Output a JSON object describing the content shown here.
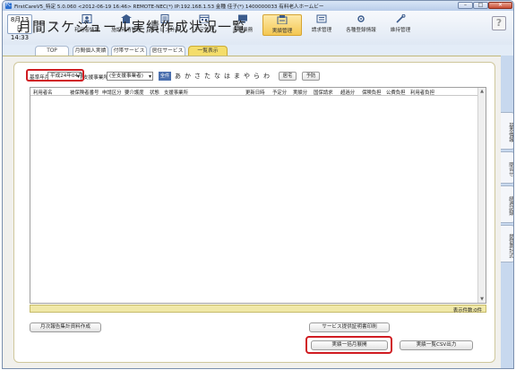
{
  "window": {
    "title": "FirstCareV5_特定 5.0.060 <2012-06-19 16:46> REMOTE-NEC(*) IP:192.168.1.53 金種 佳子(*) 1400000033 有料老人ホームビー",
    "app_icon": "FC",
    "minimize": "–",
    "maximize": "□",
    "close": "✕"
  },
  "toolbar": {
    "date": "8月13日",
    "time": "14:33",
    "back": "←",
    "forward": "→",
    "tools": [
      {
        "label": "利用者情報",
        "icon": "user-info-icon"
      },
      {
        "label": "施設利用管理",
        "icon": "facility-icon"
      },
      {
        "label": "サービス計画",
        "icon": "service-plan-icon"
      },
      {
        "label": "予定管理",
        "icon": "schedule-icon"
      },
      {
        "label": "日常業務",
        "icon": "daily-work-icon"
      },
      {
        "label": "実績管理",
        "icon": "results-icon"
      },
      {
        "label": "請求管理",
        "icon": "billing-icon"
      },
      {
        "label": "各種登録情報",
        "icon": "registration-icon"
      },
      {
        "label": "維持管理",
        "icon": "maintenance-icon"
      }
    ],
    "help": "?"
  },
  "tabs": [
    "TOP",
    "月間個人実績",
    "付帯サービス",
    "居住サービス",
    "一覧表示"
  ],
  "active_tab": "一覧表示",
  "page_title": "月間スケジュール実績作成状況一覧",
  "filters": {
    "base_month_label": "基準年月",
    "base_month_value": "平成24年04月",
    "office_label": "支援事業所",
    "office_value": "(全支援事業者)",
    "all_button": "全件",
    "kana": [
      "あ",
      "か",
      "さ",
      "た",
      "な",
      "は",
      "ま",
      "や",
      "ら",
      "わ"
    ],
    "home_button": "居宅",
    "prevent_button": "予防"
  },
  "table": {
    "columns": [
      "利用者名",
      "被保険者番号",
      "申請区分",
      "要介護度",
      "状態",
      "支援事業所",
      "更新日時",
      "予定分",
      "実績分",
      "国保請求",
      "超過分",
      "保険負担",
      "公費負担",
      "利用者負担"
    ],
    "rows": [],
    "count_text": "表示件数:0件"
  },
  "actions": {
    "monthly_report": "月次報告集計資料作成",
    "service_print": "サービス提供証明書印刷",
    "bulk_expand": "実績一括月展開",
    "csv_export": "実績一覧CSV出力"
  },
  "side_tabs": [
    "基本情報",
    "問合せ",
    "経過記録",
    "提供票計式"
  ],
  "colors": {
    "highlight": "#d01c22",
    "active_tab": "#f4dd6a",
    "count_bar": "#f0e8a8"
  }
}
